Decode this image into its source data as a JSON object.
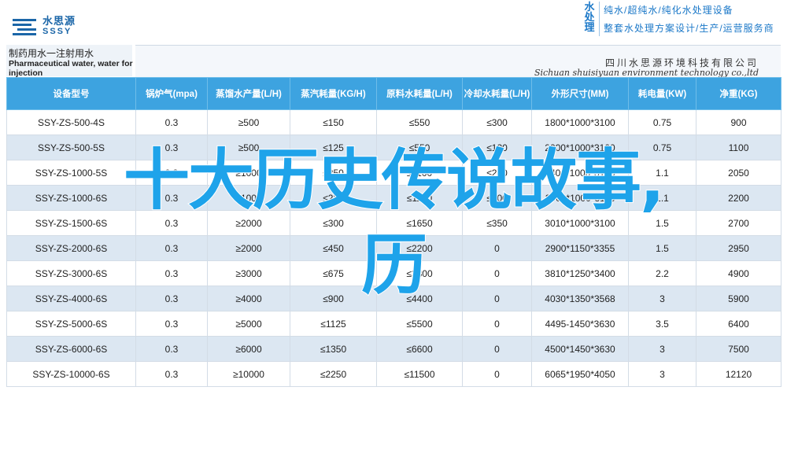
{
  "logo": {
    "name_cn": "水思源",
    "name_en": "SSSY"
  },
  "brand": {
    "vertical": "水处理",
    "line1": "纯水/超纯水/纯化水处理设备",
    "line2": "整套水处理方案设计/生产/运营服务商"
  },
  "title": {
    "cn": "制药用水一注射用水",
    "en": "Pharmaceutical water, water for injection",
    "company_cn": "四川水思源环境科技有限公司",
    "company_en": "Sichuan shuisiyuan environment technology co.,ltd"
  },
  "table": {
    "headers": [
      "设备型号",
      "锅炉气(mpa)",
      "蒸馏水产量(L/H)",
      "蒸汽耗量(KG/H)",
      "原料水耗量(L/H)",
      "冷却水耗量(L/H)",
      "外形尺寸(MM)",
      "耗电量(KW)",
      "净重(KG)"
    ],
    "rows": [
      [
        "SSY-ZS-500-4S",
        "0.3",
        "≥500",
        "≤150",
        "≤550",
        "≤300",
        "1800*1000*3100",
        "0.75",
        "900"
      ],
      [
        "SSY-ZS-500-5S",
        "0.3",
        "≥500",
        "≤125",
        "≤550",
        "≤120",
        "2000*1000*3100",
        "0.75",
        "1100"
      ],
      [
        "SSY-ZS-1000-5S",
        "0.3",
        "≥1000",
        "≤250",
        "≤1100",
        "≤240",
        "2400*1000*3100",
        "1.1",
        "2050"
      ],
      [
        "SSY-ZS-1000-6S",
        "0.3",
        "≥1000",
        "≤225",
        "≤1100",
        "≤200",
        "2600*1000*3118",
        "1.1",
        "2200"
      ],
      [
        "SSY-ZS-1500-6S",
        "0.3",
        "≥2000",
        "≤300",
        "≤1650",
        "≤350",
        "3010*1000*3100",
        "1.5",
        "2700"
      ],
      [
        "SSY-ZS-2000-6S",
        "0.3",
        "≥2000",
        "≤450",
        "≤2200",
        "0",
        "2900*1150*3355",
        "1.5",
        "2950"
      ],
      [
        "SSY-ZS-3000-6S",
        "0.3",
        "≥3000",
        "≤675",
        "≤3300",
        "0",
        "3810*1250*3400",
        "2.2",
        "4900"
      ],
      [
        "SSY-ZS-4000-6S",
        "0.3",
        "≥4000",
        "≤900",
        "≤4400",
        "0",
        "4030*1350*3568",
        "3",
        "5900"
      ],
      [
        "SSY-ZS-5000-6S",
        "0.3",
        "≥5000",
        "≤1125",
        "≤5500",
        "0",
        "4495-1450*3630",
        "3.5",
        "6400"
      ],
      [
        "SSY-ZS-6000-6S",
        "0.3",
        "≥6000",
        "≤1350",
        "≤6600",
        "0",
        "4500*1450*3630",
        "3",
        "7500"
      ],
      [
        "SSY-ZS-10000-6S",
        "0.3",
        "≥10000",
        "≤2250",
        "≤11500",
        "0",
        "6065*1950*4050",
        "3",
        "12120"
      ]
    ]
  },
  "overlay": {
    "line1": "十大历史传说故事,",
    "line2": "历"
  }
}
